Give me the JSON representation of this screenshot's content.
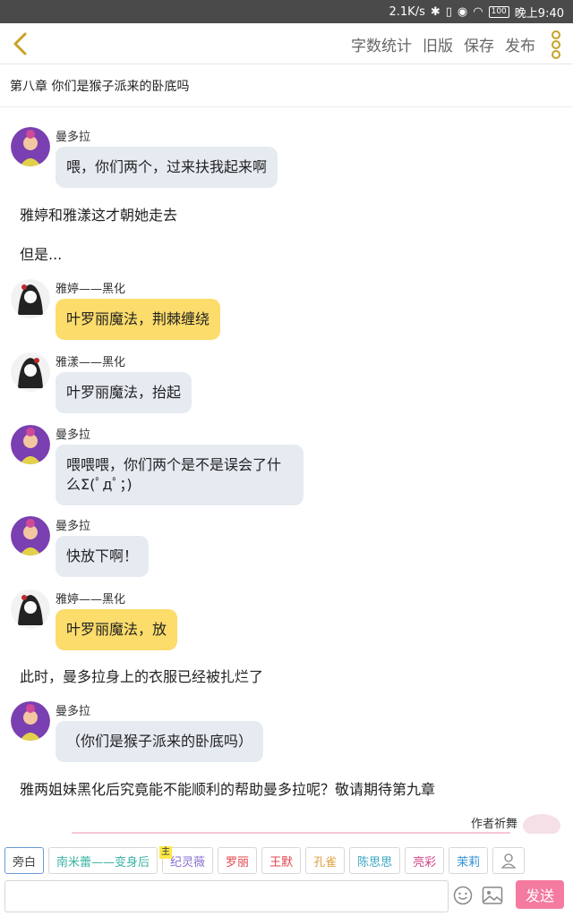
{
  "status_bar": {
    "speed": "2.1K/s",
    "battery": "100",
    "time": "晚上9:40"
  },
  "toolbar": {
    "actions": [
      "字数统计",
      "旧版",
      "保存",
      "发布"
    ]
  },
  "chapter_title": "第八章 你们是猴子派来的卧底吗",
  "messages": [
    {
      "kind": "chat",
      "speaker": "曼多拉",
      "text": "喂，你们两个，过来扶我起来啊",
      "style": "gray",
      "avatar": "mandora-avatar"
    },
    {
      "kind": "narration",
      "text": "雅婷和雅漾这才朝她走去"
    },
    {
      "kind": "narration",
      "text": "但是..."
    },
    {
      "kind": "chat",
      "speaker": "雅婷——黑化",
      "text": "叶罗丽魔法，荆棘缠绕",
      "style": "yellow",
      "avatar": "yating-avatar"
    },
    {
      "kind": "chat",
      "speaker": "雅漾——黑化",
      "text": "叶罗丽魔法，抬起",
      "style": "gray",
      "avatar": "yayang-avatar"
    },
    {
      "kind": "chat",
      "speaker": "曼多拉",
      "text": "喂喂喂，你们两个是不是误会了什么Σ(ﾟдﾟ；)",
      "style": "gray",
      "avatar": "mandora-avatar"
    },
    {
      "kind": "chat",
      "speaker": "曼多拉",
      "text": "快放下啊！",
      "style": "gray",
      "avatar": "mandora-avatar"
    },
    {
      "kind": "chat",
      "speaker": "雅婷——黑化",
      "text": "叶罗丽魔法，放",
      "style": "yellow",
      "avatar": "yating-avatar"
    },
    {
      "kind": "narration",
      "text": "此时，曼多拉身上的衣服已经被扎烂了"
    },
    {
      "kind": "chat",
      "speaker": "曼多拉",
      "text": "（你们是猴子派来的卧底吗）",
      "style": "gray",
      "avatar": "mandora-avatar"
    },
    {
      "kind": "narration",
      "text": "雅两姐妹黑化后究竟能不能顺利的帮助曼多拉呢？敬请期待第九章"
    }
  ],
  "author_label": "作者祈舞",
  "characters": [
    {
      "label": "旁白",
      "color": "#444444",
      "active": true
    },
    {
      "label": "南米蕾——变身后",
      "color": "#39b3a4"
    },
    {
      "label": "纪灵薇",
      "color": "#8a6fd1",
      "tag": "主"
    },
    {
      "label": "罗丽",
      "color": "#e0444a"
    },
    {
      "label": "王默",
      "color": "#e0444a"
    },
    {
      "label": "孔雀",
      "color": "#e0a040"
    },
    {
      "label": "陈思思",
      "color": "#39a6c4"
    },
    {
      "label": "亮彩",
      "color": "#d0458a"
    },
    {
      "label": "茉莉",
      "color": "#2e8fd0"
    }
  ],
  "input": {
    "placeholder": "",
    "send_label": "发送"
  },
  "colors": {
    "accent": "#f47aa0",
    "bubble_gray": "#e6eaf1",
    "bubble_yellow": "#fcdc6b"
  }
}
